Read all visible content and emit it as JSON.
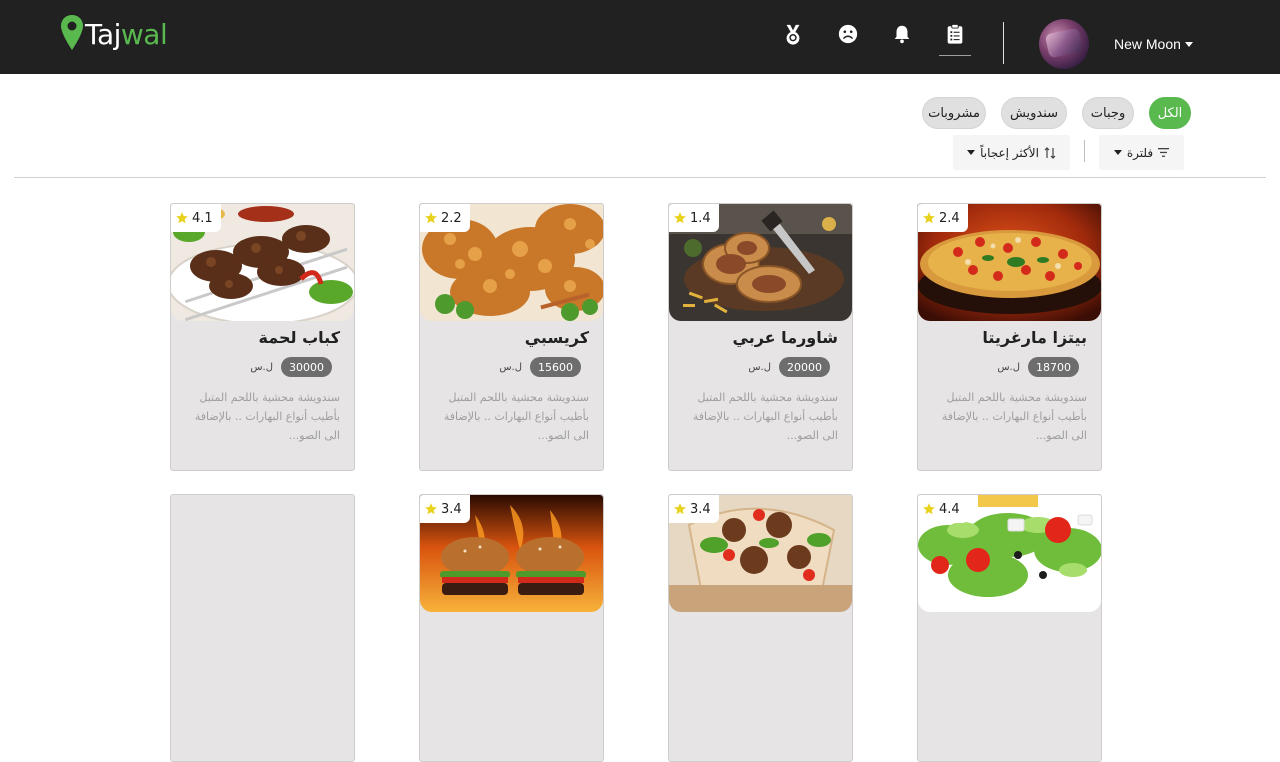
{
  "header": {
    "logo": {
      "part1": "Taj",
      "part2": "wal"
    },
    "icons": [
      "medal-icon",
      "sad-face-icon",
      "bell-icon",
      "clipboard-icon"
    ],
    "user": {
      "name": "New Moon"
    }
  },
  "categories": [
    {
      "label": "الكل",
      "active": true
    },
    {
      "label": "وجبات",
      "active": false
    },
    {
      "label": "سندويش",
      "active": false
    },
    {
      "label": "مشروبات",
      "active": false
    }
  ],
  "toolbar": {
    "filter_label": "فلترة",
    "sort_label": "الأكثر إعجاباً"
  },
  "colors": {
    "accent": "#59b94f",
    "navbar": "#212121",
    "card_bg": "#e6e4e4",
    "star": "#e8d21d"
  },
  "products": [
    {
      "name": "بيتزا مارغريتا",
      "rating": "2.4",
      "price": "18700",
      "currency": "ل.س",
      "description": "سندويشة محشية باللحم المتبل بأطيب أنواع البهارات .. بالإضافة الى الصو..."
    },
    {
      "name": "شاورما عربي",
      "rating": "1.4",
      "price": "20000",
      "currency": "ل.س",
      "description": "سندويشة محشية باللحم المتبل بأطيب أنواع البهارات .. بالإضافة الى الصو..."
    },
    {
      "name": "كريسبي",
      "rating": "2.2",
      "price": "15600",
      "currency": "ل.س",
      "description": "سندويشة محشية باللحم المتبل بأطيب أنواع البهارات .. بالإضافة الى الصو..."
    },
    {
      "name": "كباب لحمة",
      "rating": "4.1",
      "price": "30000",
      "currency": "ل.س",
      "description": "سندويشة محشية باللحم المتبل بأطيب أنواع البهارات .. بالإضافة الى الصو..."
    },
    {
      "rating": "4.4"
    },
    {
      "rating": "3.4"
    },
    {
      "rating": "3.4"
    },
    {}
  ]
}
